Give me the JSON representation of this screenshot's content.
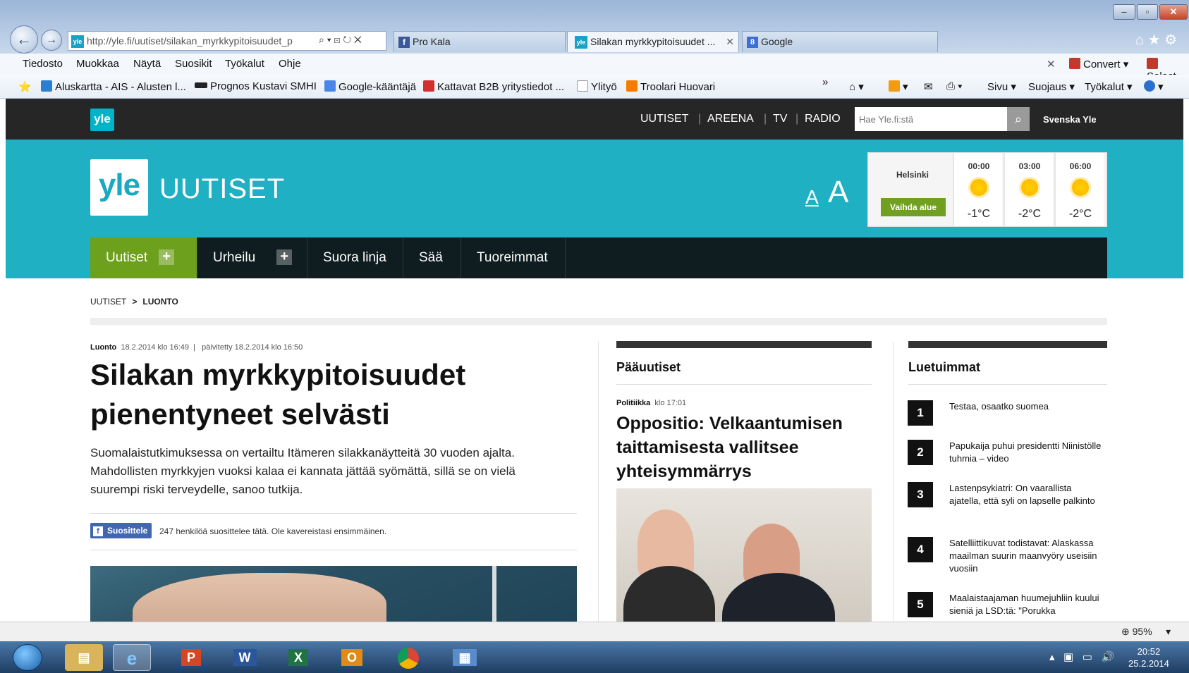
{
  "browser": {
    "address": "http://yle.fi/uutiset/silakan_myrkkypitoisuudet_p",
    "address_domain": "yle.fi",
    "tabs": [
      {
        "label": "Pro Kala"
      },
      {
        "label": "Silakan myrkkypitoisuudet ..."
      },
      {
        "label": "Google"
      }
    ],
    "menu": [
      "Tiedosto",
      "Muokkaa",
      "Näytä",
      "Suosikit",
      "Työkalut",
      "Ohje"
    ],
    "right_menu": {
      "convert": "Convert",
      "select": "Select"
    },
    "favorites": [
      "Aluskartta - AIS - Alusten l...",
      "Prognos Kustavi  SMHI",
      "Google-kääntäjä",
      "Kattavat B2B yritystiedot ...",
      "Ylityö",
      "Troolari Huovari"
    ],
    "command_bar": [
      "Sivu",
      "Suojaus",
      "Työkalut"
    ],
    "more": "»",
    "zoom": "95%"
  },
  "site": {
    "top_nav": [
      "UUTISET",
      "AREENA",
      "TV",
      "RADIO"
    ],
    "search_placeholder": "Hae Yle.fi:stä",
    "svenska": "Svenska Yle",
    "logo_small": "yle",
    "logo": "yle",
    "section_title": "UUTISET",
    "text_small": "A",
    "text_large": "A",
    "weather": {
      "city": "Helsinki",
      "change_button": "Vaihda alue",
      "hours": [
        "00:00",
        "03:00",
        "06:00"
      ],
      "temps": [
        "-1°C",
        "-2°C",
        "-2°C"
      ]
    },
    "main_nav": [
      "Uutiset",
      "Urheilu",
      "Suora linja",
      "Sää",
      "Tuoreimmat"
    ],
    "breadcrumb": {
      "root": "UUTISET",
      "current": "LUONTO"
    }
  },
  "article": {
    "category": "Luonto",
    "published": "18.2.2014 klo 16:49",
    "updated": "päivitetty 18.2.2014 klo 16:50",
    "title": "Silakan myrkkypitoisuudet pienentyneet selvästi",
    "lead": "Suomalaistutkimuksessa on vertailtu Itämeren silakkanäytteitä 30 vuoden ajalta. Mahdollisten myrkkyjen vuoksi kalaa ei kannata jättää syömättä, sillä se on vielä suurempi riski terveydelle, sanoo tutkija.",
    "fb_button": "Suosittele",
    "fb_text": "247 henkilöä suosittelee tätä. Ole kavereistasi ensimmäinen."
  },
  "paauutiset": {
    "heading": "Pääuutiset",
    "category": "Politiikka",
    "time": "klo 17:01",
    "title": "Oppositio: Velkaantumisen taittamisesta vallitsee yhteisymmärrys"
  },
  "luetuimmat": {
    "heading": "Luetuimmat",
    "items": [
      {
        "num": "1",
        "text": "Testaa, osaatko suomea"
      },
      {
        "num": "2",
        "text": "Papukaija puhui presidentti Niinistölle tuhmia – video"
      },
      {
        "num": "3",
        "text": "Lastenpsykiatri: On vaarallista ajatella, että syli on lapselle palkinto"
      },
      {
        "num": "4",
        "text": "Satelliittikuvat todistavat: Alaskassa maailman suurin maanvyöry useisiin vuosiin"
      },
      {
        "num": "5",
        "text": "Maalaistaajaman huumejuhliin kuului sieniä ja LSD:tä: \"Porukka"
      }
    ]
  },
  "taskbar": {
    "time": "20:52",
    "date": "25.2.2014"
  },
  "colors": {
    "yle_teal": "#1fb0c4",
    "nav_dark": "#0f1d20",
    "nav_active": "#6da01c",
    "topbar": "#262626"
  }
}
